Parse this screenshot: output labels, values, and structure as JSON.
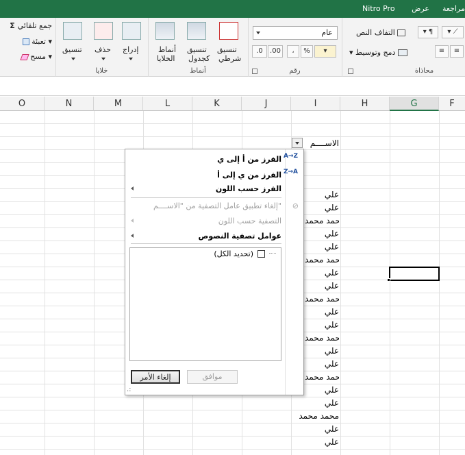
{
  "ribbon_tabs": [
    "مراجعة",
    "عرض",
    "Nitro Pro"
  ],
  "ribbon": {
    "editing": {
      "autosum": "جمع تلقائي",
      "fill": "تعبئة",
      "clear": "مسح"
    },
    "cells": {
      "format": "تنسيق",
      "delete": "حذف",
      "insert": "إدراج",
      "label": "خلايا"
    },
    "styles": {
      "cell_styles_1": "أنماط",
      "cell_styles_2": "الخلايا",
      "format_table_1": "تنسيق",
      "format_table_2": "كجدول",
      "conditional_1": "تنسيق",
      "conditional_2": "شرطي",
      "label": "أنماط"
    },
    "number": {
      "format_value": "عام",
      "label": "رقم",
      "percent": "%",
      "comma": "،"
    },
    "alignment": {
      "wrap_text": "التفاف النص",
      "merge_center": "دمج وتوسيط",
      "label": "محاذاة"
    }
  },
  "columns": [
    "O",
    "N",
    "M",
    "L",
    "K",
    "J",
    "I",
    "H",
    "G",
    "F"
  ],
  "active_column": "G",
  "cells": {
    "header": "الاســــم",
    "rows": [
      "علي",
      "علي",
      "محمد محمد",
      "علي",
      "علي",
      "محمد محمد",
      "علي",
      "علي",
      "محمد محمد",
      "علي",
      "علي",
      "محمد محمد",
      "علي",
      "علي",
      "محمد محمد",
      "علي",
      "علي",
      "محمد محمد",
      "علي",
      "علي"
    ]
  },
  "filter_menu": {
    "sort_asc": "الفرز من أ إلى ي",
    "sort_desc": "الفرز من ي إلى أ",
    "sort_by_color": "الفرز حسب اللون",
    "clear_filter": "إلغاء تطبيق عامل التصفية من \"الاســــم\"",
    "filter_by_color": "التصفية حسب اللون",
    "text_filters": "عوامل تصفية النصوص",
    "select_all": "(تحديد الكل)",
    "ok": "موافق",
    "cancel": "إلغاء الأمر",
    "sort_icon_az": "A→Z",
    "sort_icon_za": "Z→A"
  }
}
